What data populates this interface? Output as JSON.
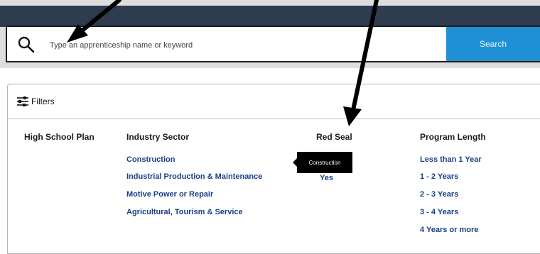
{
  "search": {
    "placeholder": "Type an apprenticeship name or keyword",
    "button_label": "Search"
  },
  "filters": {
    "label": "Filters",
    "columns": [
      {
        "heading": "High School Plan",
        "options": []
      },
      {
        "heading": "Industry Sector",
        "options": [
          "Construction",
          "Industrial Production & Maintenance",
          "Motive Power or Repair",
          "Agricultural, Tourism & Service"
        ]
      },
      {
        "heading": "Red Seal",
        "options": [
          "Yes"
        ]
      },
      {
        "heading": "Program Length",
        "options": [
          "Less than 1 Year",
          "1 - 2 Years",
          "2 - 3 Years",
          "3 - 4 Years",
          "4 Years or more"
        ]
      }
    ]
  },
  "tooltip": {
    "text": "Construction"
  },
  "icons": {
    "search": "search-icon",
    "filters": "sliders-icon"
  },
  "colors": {
    "top_bar": "#2f3b4e",
    "search_button": "#1f8fd6",
    "link": "#183f86",
    "tooltip_bg": "#000000"
  }
}
